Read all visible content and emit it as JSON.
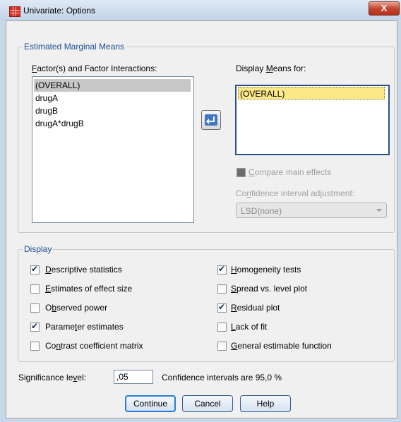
{
  "window": {
    "title": "Univariate: Options",
    "close_label": "X"
  },
  "emm": {
    "group_title": "Estimated Marginal Means",
    "factors_label": "Factor(s) and Factor Interactions:",
    "factors": [
      "(OVERALL)",
      "drugA",
      "drugB",
      "drugA*drugB"
    ],
    "display_means_label": "Display Means for:",
    "display_means": [
      "(OVERALL)"
    ],
    "compare_label": "Compare main effects",
    "ci_adjust_label": "Confidence interval adjustment:",
    "ci_adjust_value": "LSD(none)"
  },
  "display": {
    "group_title": "Display",
    "options": {
      "descriptive": {
        "label": "Descriptive statistics",
        "checked": true
      },
      "effect_size": {
        "label": "Estimates of effect size",
        "checked": false
      },
      "observed_power": {
        "label": "Observed power",
        "checked": false
      },
      "parameter": {
        "label": "Parameter estimates",
        "checked": true
      },
      "contrast": {
        "label": "Contrast coefficient matrix",
        "checked": false
      },
      "homogeneity": {
        "label": "Homogeneity tests",
        "checked": true
      },
      "spread_level": {
        "label": "Spread vs. level plot",
        "checked": false
      },
      "residual": {
        "label": "Residual plot",
        "checked": true
      },
      "lack_of_fit": {
        "label": "Lack of fit",
        "checked": false
      },
      "general_estimable": {
        "label": "General estimable function",
        "checked": false
      }
    }
  },
  "significance": {
    "label": "Significance level:",
    "value": ",05",
    "ci_text": "Confidence intervals are 95,0 %"
  },
  "buttons": {
    "continue": "Continue",
    "cancel": "Cancel",
    "help": "Help"
  }
}
